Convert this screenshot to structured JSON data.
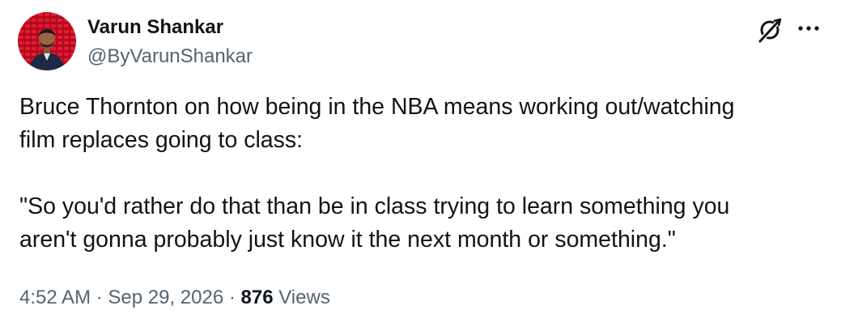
{
  "author": {
    "name": "Varun Shankar",
    "handle": "@ByVarunShankar"
  },
  "icons": {
    "grok": "grok-icon",
    "more": "more-options-icon"
  },
  "tweet": {
    "line1": "Bruce Thornton on how being in the NBA means working out/watching\nfilm replaces going to class:",
    "line2": "\"So you'd rather do that than be in class trying to learn something you\naren't gonna probably just know it the next month or something.\""
  },
  "meta": {
    "time": "4:52 AM",
    "separator1": " · ",
    "date": "Sep 29, 2026",
    "separator2": " · ",
    "views_count": "876",
    "views_label": " Views"
  },
  "colors": {
    "text_primary": "#0f1419",
    "text_secondary": "#536471",
    "avatar_bg": "#c8102e"
  }
}
